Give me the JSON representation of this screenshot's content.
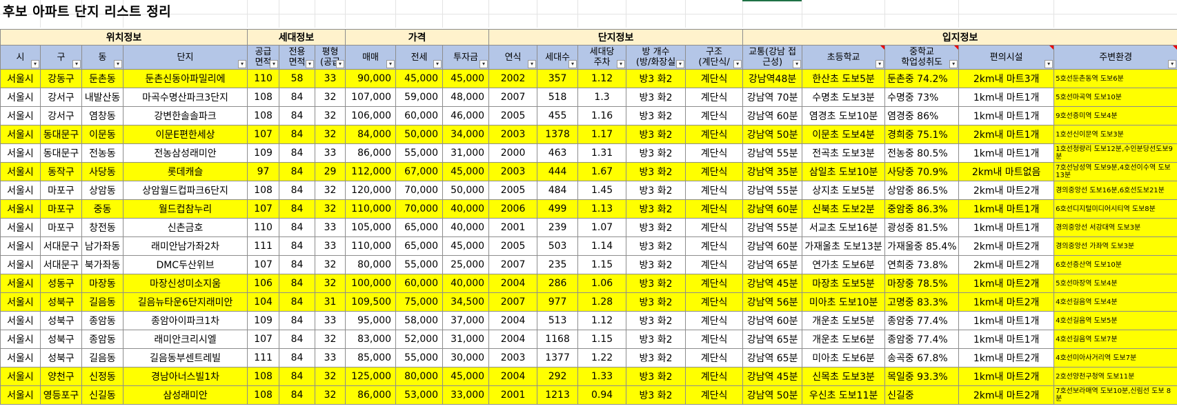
{
  "title": "후보 아파트 단지 리스트 정리",
  "groups": [
    "위치정보",
    "세대정보",
    "가격",
    "단지정보",
    "입지정보"
  ],
  "headers": [
    [
      "시"
    ],
    [
      "구"
    ],
    [
      "동"
    ],
    [
      "단지"
    ],
    [
      "공급",
      "면적"
    ],
    [
      "전용",
      "면적"
    ],
    [
      "평형",
      "(공급"
    ],
    [
      "매매"
    ],
    [
      "전세"
    ],
    [
      "투자금"
    ],
    [
      "연식"
    ],
    [
      "세대수"
    ],
    [
      "세대당",
      "주차"
    ],
    [
      "방 개수",
      "(방/화장실"
    ],
    [
      "구조",
      "(계단식/"
    ],
    [
      "교통(강남 접",
      "근성)"
    ],
    [
      "초등학교"
    ],
    [
      "중학교",
      "학업성취도"
    ],
    [
      "편의시설"
    ],
    [
      "주변환경"
    ]
  ],
  "rows": [
    {
      "hl": true,
      "c": [
        "서울시",
        "강동구",
        "둔촌동",
        "둔촌신동아파밀리에",
        "110",
        "58",
        "33",
        "90,000",
        "45,000",
        "45,000",
        "2002",
        "357",
        "1.12",
        "방3 화2",
        "계단식",
        "강남역48분",
        "한산초 도보5분",
        "둔촌중 74.2%",
        "2km내 마트3개",
        "5호선둔촌동역 도보6분"
      ]
    },
    {
      "hl": false,
      "c": [
        "서울시",
        "강서구",
        "내발산동",
        "마곡수명산파크3단지",
        "108",
        "84",
        "32",
        "107,000",
        "59,000",
        "48,000",
        "2007",
        "518",
        "1.3",
        "방3 화2",
        "계단식",
        "강남역 70분",
        "수명초 도보3분",
        "수명중 73%",
        "1km내 마트1개",
        "5호선마곡역 도보10분"
      ]
    },
    {
      "hl": false,
      "c": [
        "서울시",
        "강서구",
        "염창동",
        "강변한솔솔파크",
        "108",
        "84",
        "32",
        "106,000",
        "60,000",
        "46,000",
        "2005",
        "455",
        "1.16",
        "방3 화2",
        "계단식",
        "강남역 60분",
        "염경초 도보10분",
        "염경중 86%",
        "1km내 마트1개",
        "9호선증미역 도보4분"
      ]
    },
    {
      "hl": true,
      "c": [
        "서울시",
        "동대문구",
        "이문동",
        "이문E편한세상",
        "107",
        "84",
        "32",
        "84,000",
        "50,000",
        "34,000",
        "2003",
        "1378",
        "1.17",
        "방3 화2",
        "계단식",
        "강남역 50분",
        "이문초 도보4분",
        "경희중 75.1%",
        "2km내 마트1개",
        "1호선신이문역 도보3분"
      ]
    },
    {
      "hl": false,
      "c": [
        "서울시",
        "동대문구",
        "전농동",
        "전농삼성래미안",
        "109",
        "84",
        "33",
        "86,000",
        "55,000",
        "31,000",
        "2000",
        "463",
        "1.31",
        "방3 화2",
        "계단식",
        "강남역 55분",
        "전곡초 도보3분",
        "전농중 80.5%",
        "1km내 마트1개",
        "1호선청량리 도보12분,수인분당선도보9분"
      ]
    },
    {
      "hl": true,
      "c": [
        "서울시",
        "동작구",
        "사당동",
        "롯데캐슬",
        "97",
        "84",
        "29",
        "112,000",
        "67,000",
        "45,000",
        "2003",
        "444",
        "1.67",
        "방3 화2",
        "계단식",
        "강남역 35분",
        "삼일초 도보10분",
        "사당중 70.9%",
        "2km내 마트없음",
        "7호선남성역 도보9분,4호선이수역 도보13분"
      ]
    },
    {
      "hl": false,
      "c": [
        "서울시",
        "마포구",
        "상암동",
        "상암월드컵파크6단지",
        "108",
        "84",
        "32",
        "120,000",
        "70,000",
        "50,000",
        "2005",
        "484",
        "1.45",
        "방3 화2",
        "계단식",
        "강남역 55분",
        "상지초 도보5분",
        "상암중 86.5%",
        "2km내 마트2개",
        "경의중앙선 도보16분,6호선도보21분"
      ]
    },
    {
      "hl": true,
      "c": [
        "서울시",
        "마포구",
        "중동",
        "월드컵참누리",
        "107",
        "84",
        "32",
        "110,000",
        "70,000",
        "40,000",
        "2006",
        "499",
        "1.13",
        "방3 화2",
        "계단식",
        "강남역 60분",
        "신북초 도보2분",
        "중암중 86.3%",
        "1km내 마트1개",
        "6호선디지털미디어시티역 도보8분"
      ]
    },
    {
      "hl": false,
      "c": [
        "서울시",
        "마포구",
        "창전동",
        "신촌금호",
        "110",
        "84",
        "33",
        "105,000",
        "65,000",
        "40,000",
        "2001",
        "239",
        "1.07",
        "방3 화2",
        "계단식",
        "강남역 55분",
        "서교초 도보16분",
        "광성중 81.5%",
        "1km내 마트1개",
        "경의중앙선 서강대역 도보3분"
      ]
    },
    {
      "hl": false,
      "c": [
        "서울시",
        "서대문구",
        "남가좌동",
        "래미안남가좌2차",
        "111",
        "84",
        "33",
        "110,000",
        "65,000",
        "45,000",
        "2005",
        "503",
        "1.14",
        "방3 화2",
        "계단식",
        "강남역 60분",
        "가재울초 도보13분",
        "가재울중 85.4%",
        "2km내 마트2개",
        "경의중앙선 가좌역 도보3분"
      ]
    },
    {
      "hl": false,
      "c": [
        "서울시",
        "서대문구",
        "북가좌동",
        "DMC두산위브",
        "107",
        "84",
        "32",
        "80,000",
        "55,000",
        "25,000",
        "2007",
        "235",
        "1.15",
        "방3 화2",
        "계단식",
        "강남역 65분",
        "연가초 도보6분",
        "연희중 73.8%",
        "2km내 마트2개",
        "6호선증산역 도보10분"
      ]
    },
    {
      "hl": true,
      "c": [
        "서울시",
        "성동구",
        "마장동",
        "마장신성미소지움",
        "106",
        "84",
        "32",
        "100,000",
        "60,000",
        "40,000",
        "2004",
        "286",
        "1.06",
        "방3 화2",
        "계단식",
        "강남역 45분",
        "마장초 도보5분",
        "마장중 78.5%",
        "1km내 마트2개",
        "5호선마장역 도보4분"
      ]
    },
    {
      "hl": true,
      "c": [
        "서울시",
        "성북구",
        "길음동",
        "길음뉴타운6단지래미안",
        "104",
        "84",
        "31",
        "109,500",
        "75,000",
        "34,500",
        "2007",
        "977",
        "1.28",
        "방3 화2",
        "계단식",
        "강남역 56분",
        "미아초 도보10분",
        "고명중 83.3%",
        "1km내 마트2개",
        "4호선길음역 도보4분"
      ]
    },
    {
      "hl": false,
      "c": [
        "서울시",
        "성북구",
        "종암동",
        "종암아이파크1차",
        "109",
        "84",
        "33",
        "95,000",
        "58,000",
        "37,000",
        "2004",
        "513",
        "1.12",
        "방3 화2",
        "계단식",
        "강남역 60분",
        "개운초 도보5분",
        "종암중 77.4%",
        "1km내 마트1개",
        "4호선길음역 도보5분"
      ]
    },
    {
      "hl": false,
      "c": [
        "서울시",
        "성북구",
        "종암동",
        "래미안크리시엘",
        "107",
        "84",
        "32",
        "83,000",
        "52,000",
        "31,000",
        "2004",
        "1168",
        "1.15",
        "방3 화2",
        "계단식",
        "강남역 65분",
        "개운초 도보6분",
        "종암중 77.4%",
        "1km내 마트1개",
        "4호선길음역 도보7분"
      ]
    },
    {
      "hl": false,
      "c": [
        "서울시",
        "성북구",
        "길음동",
        "길음동부센트레빌",
        "111",
        "84",
        "33",
        "85,000",
        "55,000",
        "30,000",
        "2003",
        "1377",
        "1.22",
        "방3 화2",
        "계단식",
        "강남역 65분",
        "미아초 도보6분",
        "송곡중 67.8%",
        "1km내 마트2개",
        "4호선미아사거리역 도보7분"
      ]
    },
    {
      "hl": true,
      "c": [
        "서울시",
        "양천구",
        "신정동",
        "경남아너스빌1차",
        "108",
        "84",
        "32",
        "125,000",
        "80,000",
        "45,000",
        "2004",
        "292",
        "1.33",
        "방3 화2",
        "계단식",
        "강남역 45분",
        "신목초 도보3분",
        "목일중 93.3%",
        "1km내 마트2개",
        "2호선양천구청역 도보11분"
      ]
    },
    {
      "hl": true,
      "c": [
        "서울시",
        "영등포구",
        "신길동",
        "삼성래미안",
        "108",
        "84",
        "32",
        "86,000",
        "53,000",
        "33,000",
        "2001",
        "1213",
        "0.94",
        "방3 화2",
        "계단식",
        "강남역 50분",
        "우신초 도보11분",
        "신길중",
        "2km내 마트2개",
        "7호선보라매역 도보10분,신림선 도보 8분"
      ]
    }
  ]
}
